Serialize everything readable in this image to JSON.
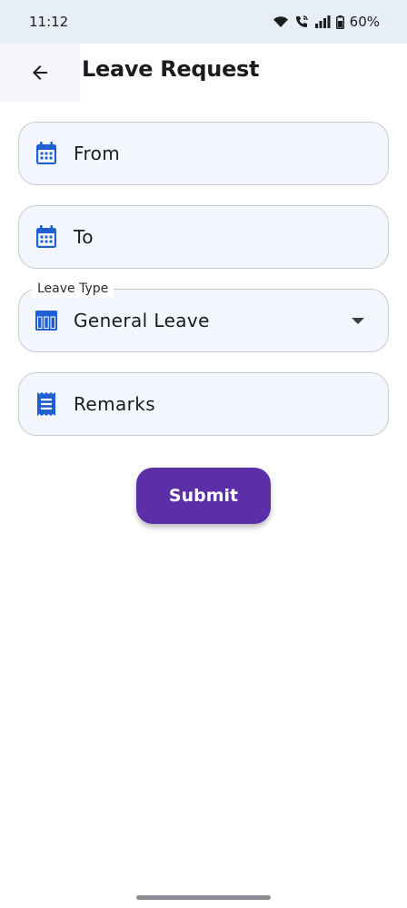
{
  "status_bar": {
    "time": "11:12",
    "battery": "60%",
    "icons": [
      "wifi-icon",
      "wifi-call-icon",
      "signal-icon",
      "battery-icon"
    ]
  },
  "app_bar": {
    "title": "Leave Request",
    "back_icon": "arrow-left-icon"
  },
  "form": {
    "from": {
      "label": "From",
      "icon": "calendar-icon"
    },
    "to": {
      "label": "To",
      "icon": "calendar-icon"
    },
    "leave_type": {
      "floating_label": "Leave Type",
      "value": "General Leave",
      "icon": "table-icon"
    },
    "remarks": {
      "label": "Remarks",
      "icon": "receipt-icon"
    },
    "submit_label": "Submit"
  },
  "colors": {
    "accent": "#5a2fa8",
    "icon_blue": "#1f5fd1",
    "field_bg": "#f3f6fc",
    "field_border": "#c7cbd4",
    "status_bar_bg": "#e8eef6"
  }
}
